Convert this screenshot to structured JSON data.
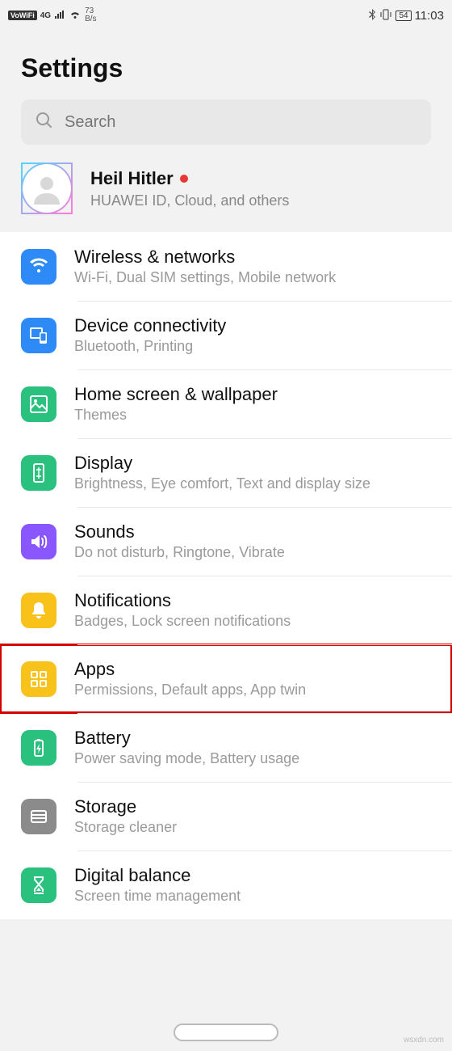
{
  "status": {
    "vowifi": "VoWiFi",
    "net_label": "4G",
    "speed_top": "73",
    "speed_bottom": "B/s",
    "battery": "54",
    "time": "11:03"
  },
  "header": {
    "title": "Settings"
  },
  "search": {
    "placeholder": "Search"
  },
  "account": {
    "name": "Heil Hitler",
    "sub": "HUAWEI ID, Cloud, and others"
  },
  "rows": [
    {
      "icon": "wifi-icon",
      "color": "#2d8af7",
      "title": "Wireless & networks",
      "sub": "Wi-Fi, Dual SIM settings, Mobile network"
    },
    {
      "icon": "device-icon",
      "color": "#2d8af7",
      "title": "Device connectivity",
      "sub": "Bluetooth, Printing"
    },
    {
      "icon": "home-icon",
      "color": "#2ac17e",
      "title": "Home screen & wallpaper",
      "sub": "Themes"
    },
    {
      "icon": "display-icon",
      "color": "#2ac17e",
      "title": "Display",
      "sub": "Brightness, Eye comfort, Text and display size"
    },
    {
      "icon": "sound-icon",
      "color": "#8a56ff",
      "title": "Sounds",
      "sub": "Do not disturb, Ringtone, Vibrate"
    },
    {
      "icon": "bell-icon",
      "color": "#f9c21b",
      "title": "Notifications",
      "sub": "Badges, Lock screen notifications"
    },
    {
      "icon": "apps-icon",
      "color": "#f9c21b",
      "title": "Apps",
      "sub": "Permissions, Default apps, App twin",
      "highlighted": true
    },
    {
      "icon": "battery-icon",
      "color": "#2ac17e",
      "title": "Battery",
      "sub": "Power saving mode, Battery usage"
    },
    {
      "icon": "storage-icon",
      "color": "#8b8b8b",
      "title": "Storage",
      "sub": "Storage cleaner"
    },
    {
      "icon": "hourglass-icon",
      "color": "#2ac17e",
      "title": "Digital balance",
      "sub": "Screen time management"
    }
  ],
  "watermark": "wsxdn.com"
}
